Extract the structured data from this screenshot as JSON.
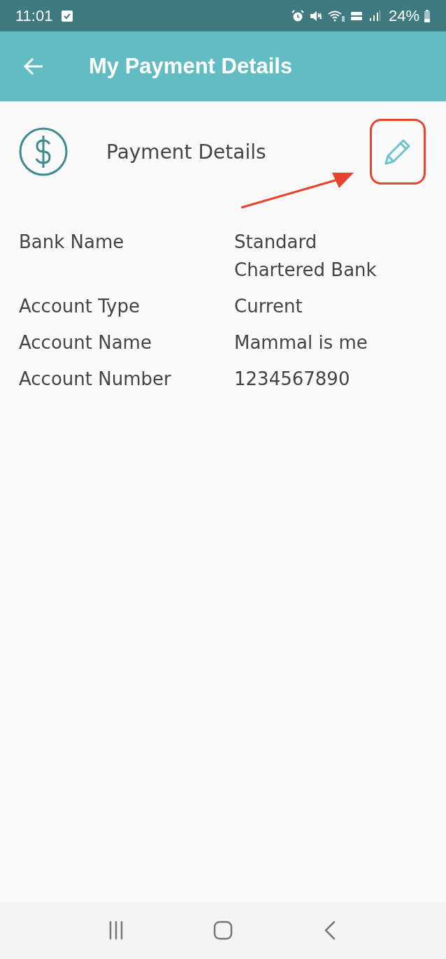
{
  "status_bar": {
    "time": "11:01",
    "battery": "24%"
  },
  "app_bar": {
    "title": "My Payment Details"
  },
  "section": {
    "title": "Payment Details",
    "edit_button": {
      "highlighted": true
    }
  },
  "details": [
    {
      "label": "Bank Name",
      "value": "Standard Chartered Bank"
    },
    {
      "label": "Account Type",
      "value": "Current"
    },
    {
      "label": "Account Name",
      "value": "Mammal is me"
    },
    {
      "label": "Account Number",
      "value": "1234567890"
    }
  ]
}
